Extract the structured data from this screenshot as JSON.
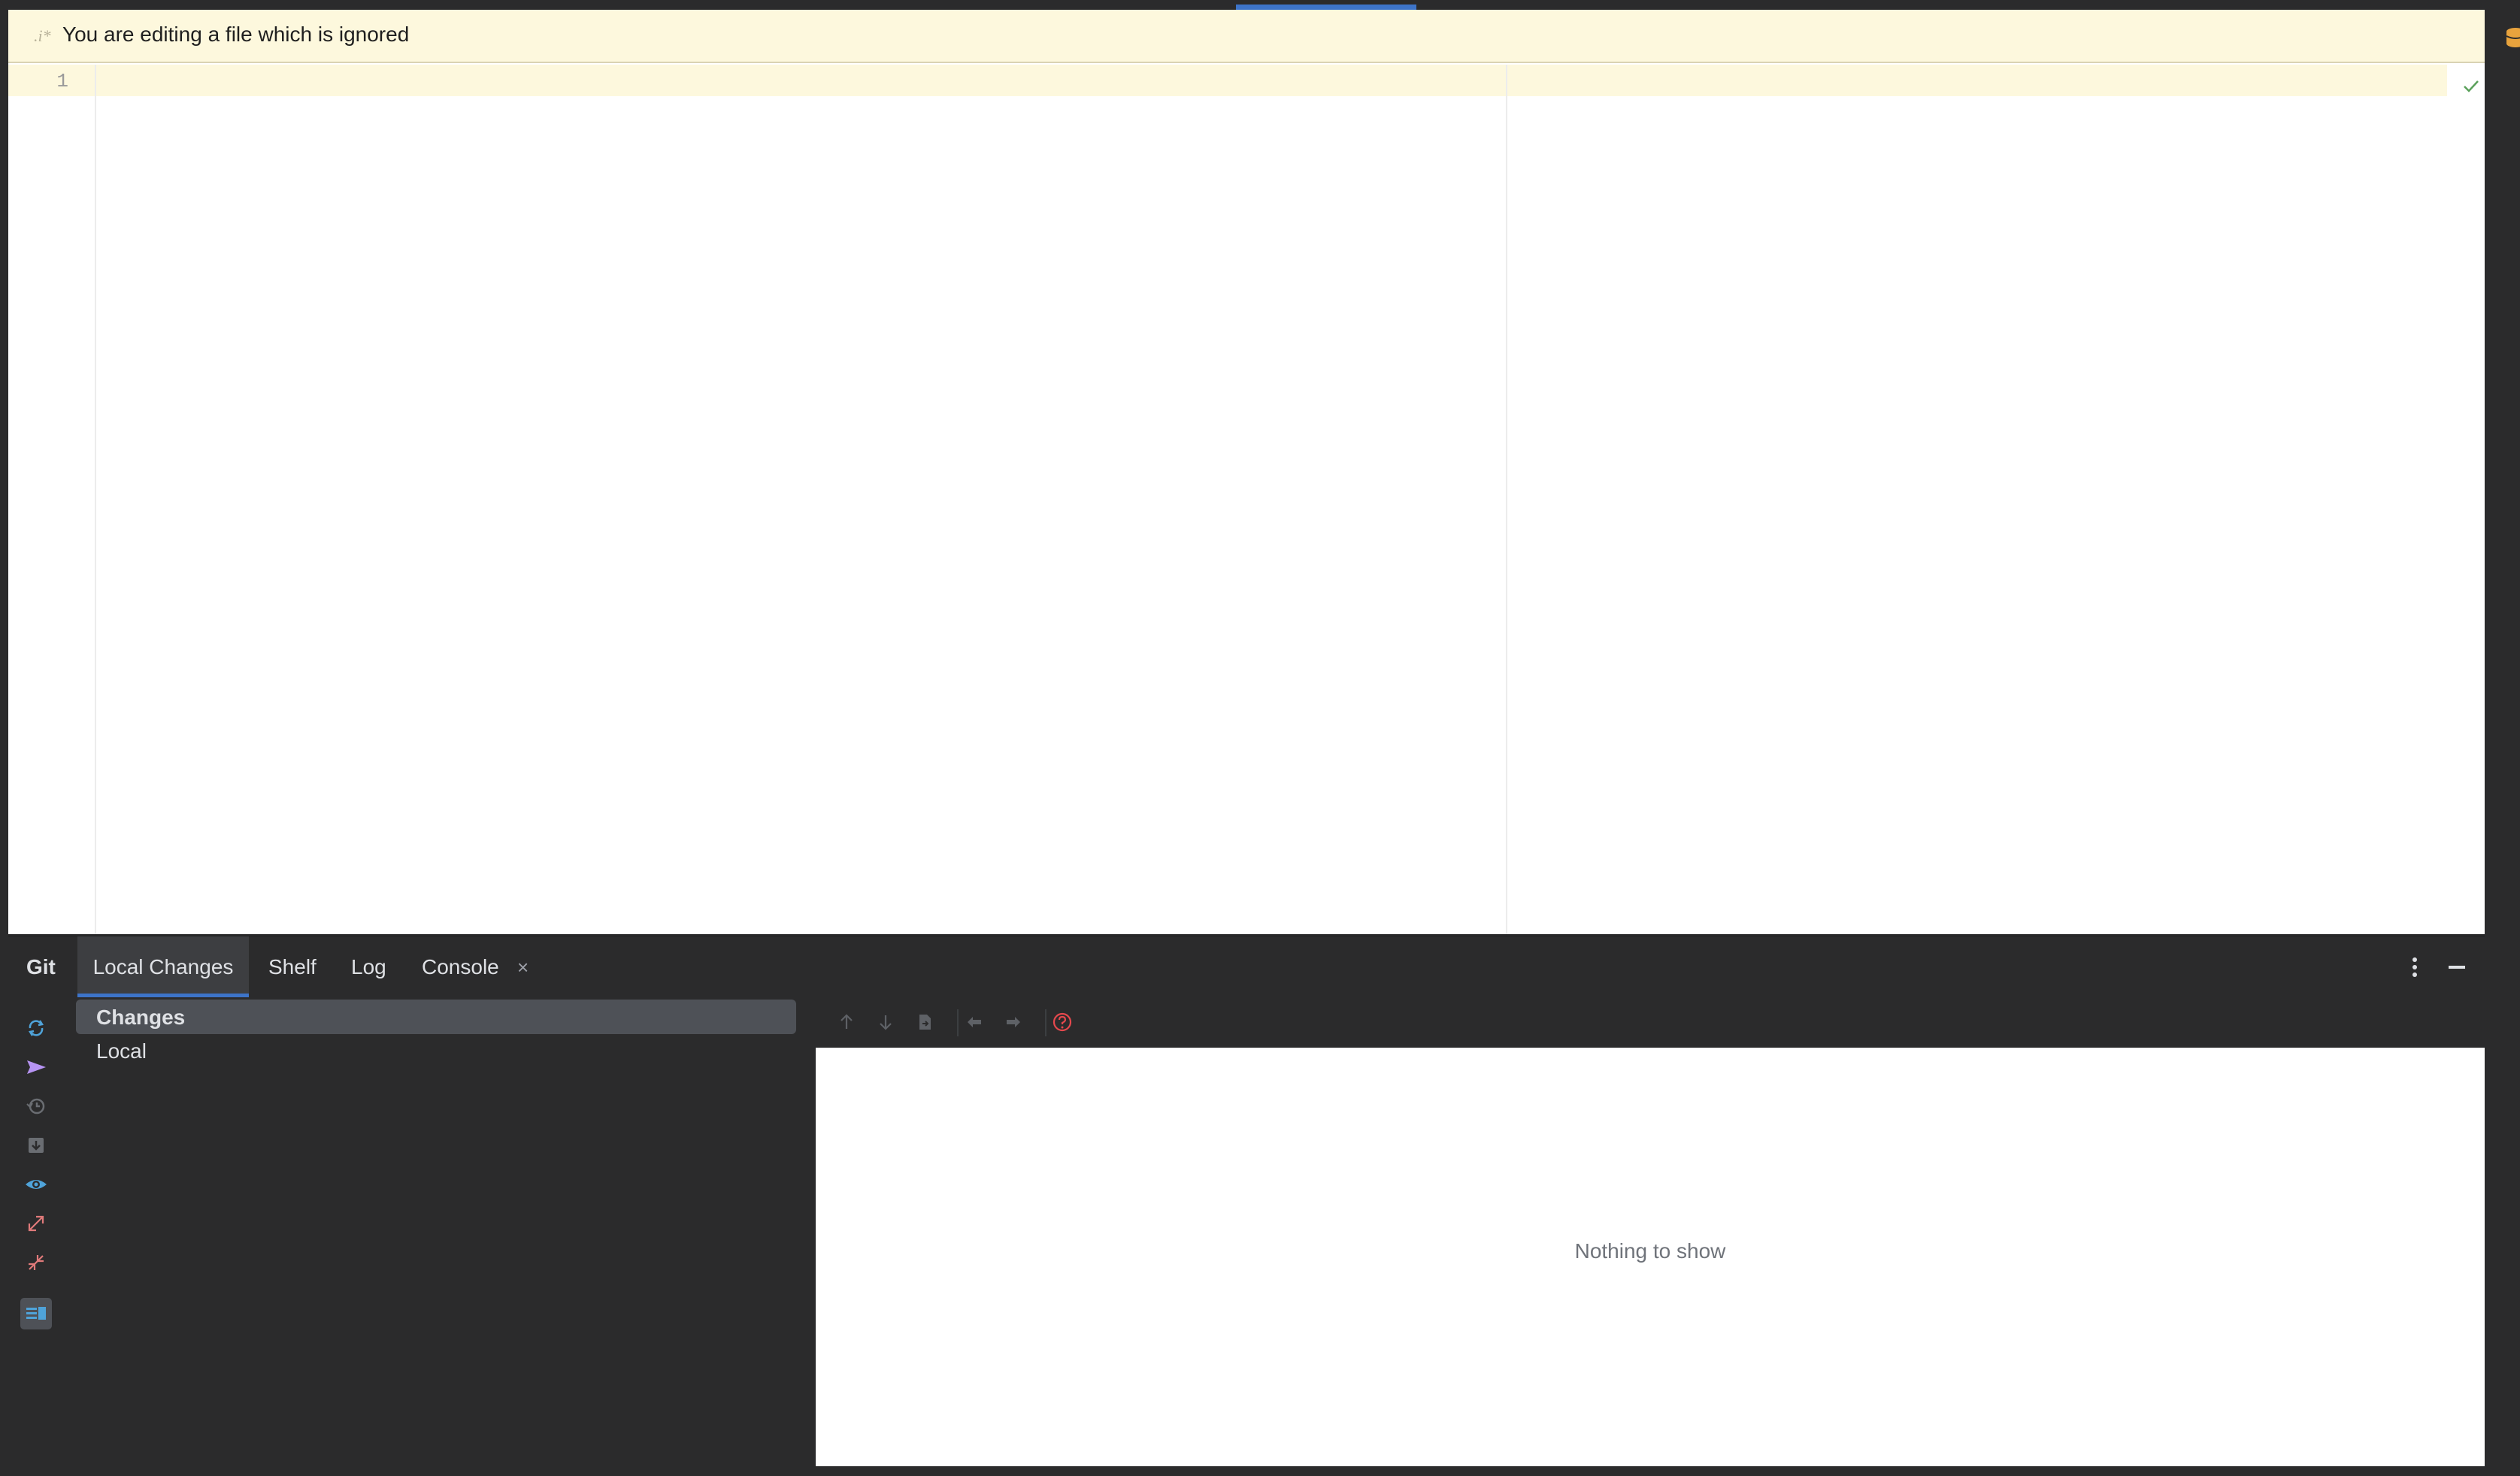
{
  "editor": {
    "banner_text": "You are editing a file which is ignored",
    "line_number": "1"
  },
  "tool_window": {
    "title": "Git",
    "tabs": [
      {
        "label": "Local Changes"
      },
      {
        "label": "Shelf"
      },
      {
        "label": "Log"
      },
      {
        "label": "Console"
      }
    ],
    "close_glyph": "×",
    "left_toolbar_icons": [
      "refresh-icon",
      "push-arrow-icon",
      "rollback-icon",
      "shelve-icon",
      "eye-icon",
      "expand-icon",
      "collapse-icon",
      "show-diff-preview-icon"
    ],
    "tree": {
      "items": [
        {
          "label": "Changes"
        },
        {
          "label": "Local"
        }
      ]
    },
    "diff": {
      "toolbar_icons": [
        "up-arrow-icon",
        "down-arrow-icon",
        "jump-to-source-icon",
        "previous-diff-icon",
        "next-diff-icon",
        "help-icon"
      ],
      "empty_text": "Nothing to show"
    }
  },
  "colors": {
    "accent": "#3d74c9",
    "banner_bg": "#fdf8dd",
    "panel_bg": "#2b2b2c",
    "ok_check": "#5aa05a",
    "help_red": "#e5484d",
    "push_purple": "#b794f4",
    "sync_blue": "#4fa3d9"
  }
}
